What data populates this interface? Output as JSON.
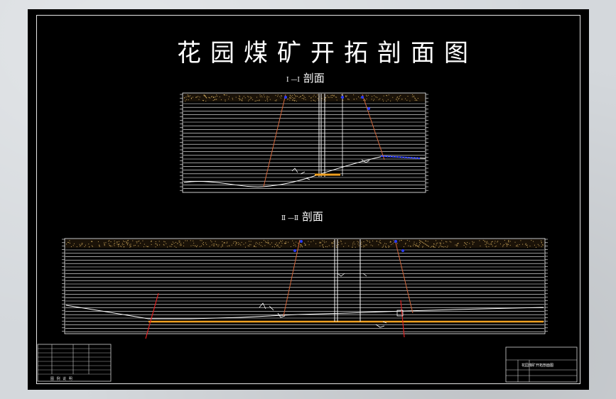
{
  "drawing": {
    "title": "花园煤矿开拓剖面图",
    "section1_label_roman": "Ⅰ —Ⅰ",
    "section1_label_text": "剖面",
    "section2_label_roman": "Ⅱ —Ⅱ",
    "section2_label_text": "剖面"
  },
  "legend": {
    "caption": "图 例 说 明"
  },
  "title_block": {
    "drawing_name": "花园煤矿开拓剖面图"
  },
  "colors": {
    "background": "#000000",
    "frame": "#e6e6e6",
    "strata_lines": "#ffffff",
    "topsoil_dots": "#c9a55a",
    "fault_lines": "#d4663a",
    "coal_seam": "#f0a020",
    "blue_markers": "#2a3cff",
    "red_fault": "#e02020"
  }
}
